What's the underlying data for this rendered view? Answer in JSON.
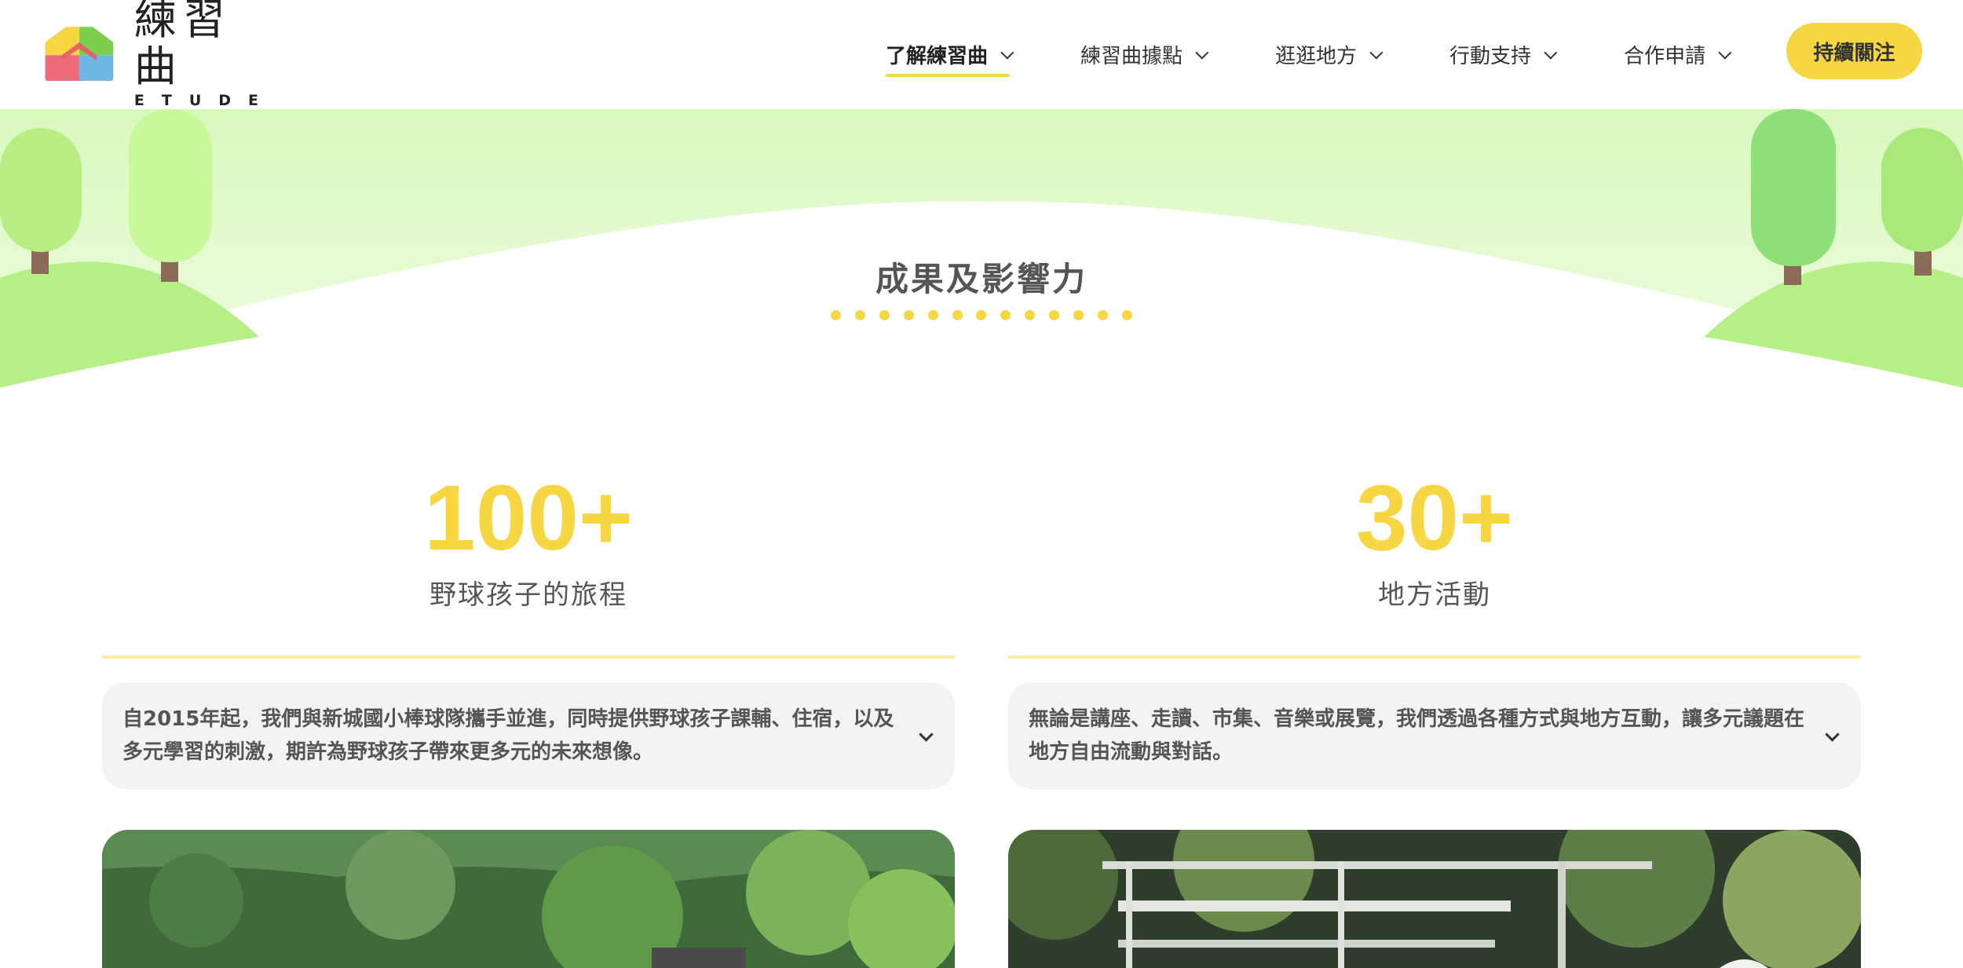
{
  "header": {
    "logo": {
      "cn": "練習曲",
      "en": "ETUDE"
    },
    "nav": [
      {
        "label": "了解練習曲",
        "active": true
      },
      {
        "label": "練習曲據點",
        "active": false
      },
      {
        "label": "逛逛地方",
        "active": false
      },
      {
        "label": "行動支持",
        "active": false
      },
      {
        "label": "合作申請",
        "active": false
      }
    ],
    "follow_button": "持續關注"
  },
  "section": {
    "title": "成果及影響力"
  },
  "stats": [
    {
      "number": "100+",
      "label": "野球孩子的旅程",
      "description": "自2015年起，我們與新城國小棒球隊攜手並進，同時提供野球孩子課輔、住宿，以及多元學習的刺激，期許為野球孩子帶來更多元的未來想像。"
    },
    {
      "number": "30+",
      "label": "地方活動",
      "description": "無論是講座、走讀、市集、音樂或展覽，我們透過各種方式與地方互動，讓多元議題在地方自由流動與對話。"
    }
  ],
  "colors": {
    "accent": "#f6d743",
    "accent_light": "#fbe9a4",
    "hill_green": "#c5f59a",
    "bg_green": "#e9fcd7",
    "tree_green": "#8fdf78",
    "trunk": "#8b6a5a",
    "desc_bg": "#f3f3f3"
  },
  "icons": [
    "logo-house-icon",
    "chevron-down-icon",
    "tree-icon"
  ]
}
